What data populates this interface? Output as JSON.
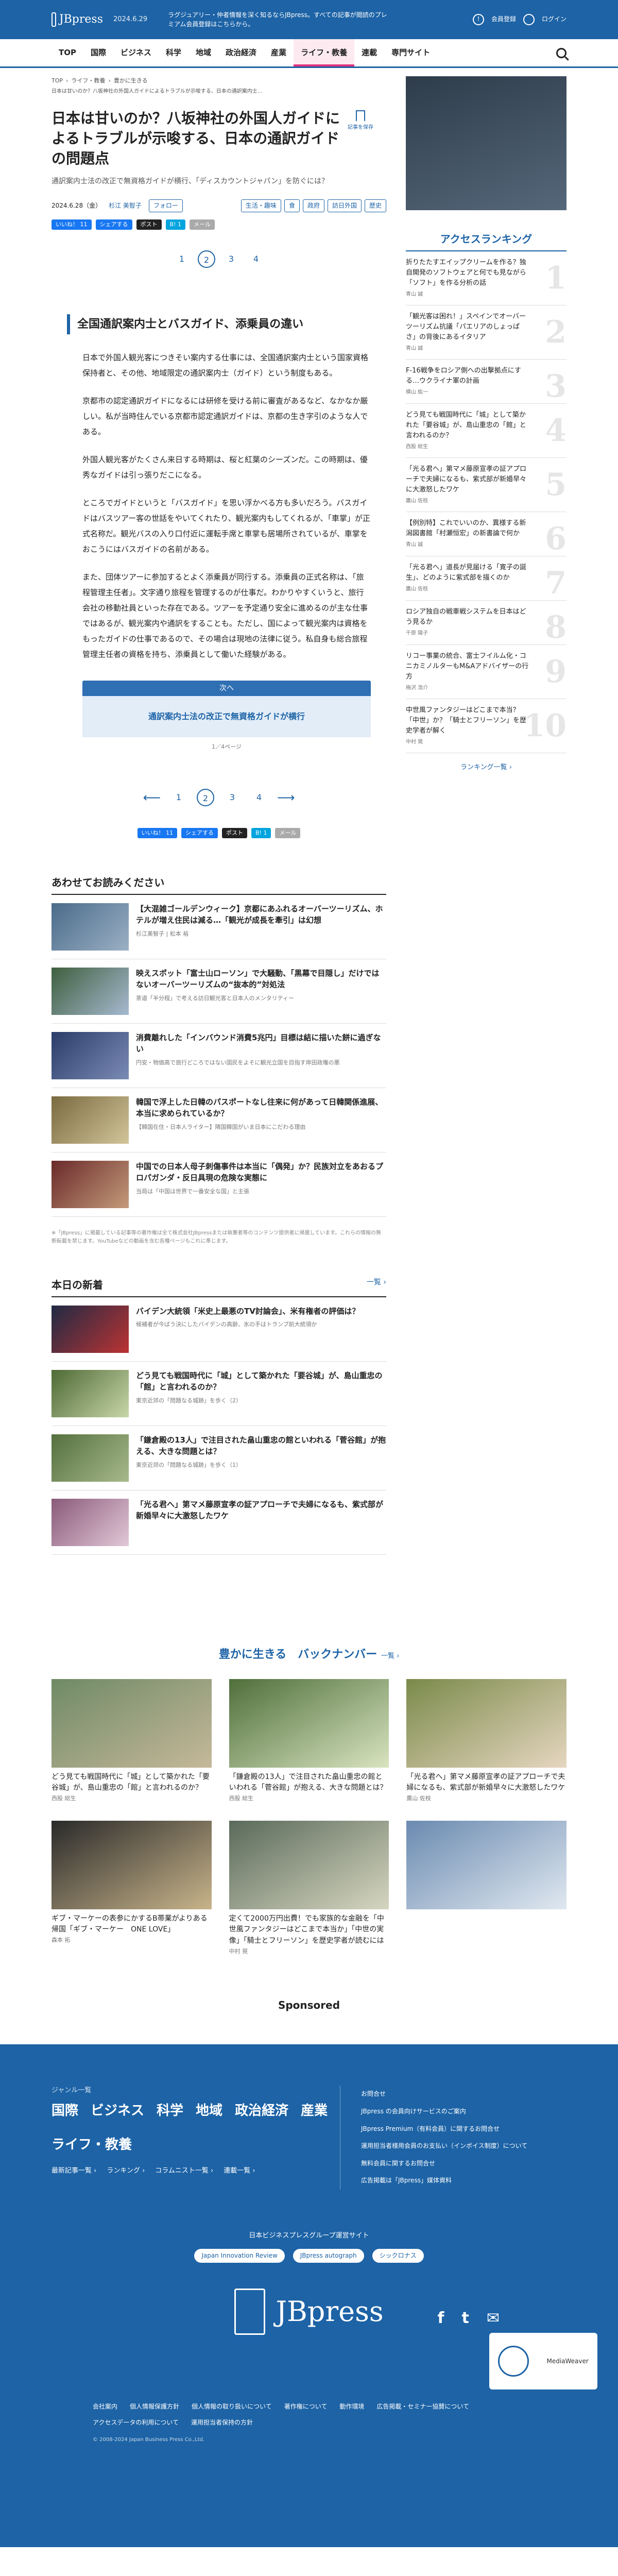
{
  "topbar": {
    "logo": "JBpress",
    "date": "2024.6.29",
    "tagline": "ラグジュアリー・仲者情報を深く知るならJBpress。すべての記事が閲読のプレミアム会員登録はこちらから。",
    "member": "会員登録",
    "login": "ログイン"
  },
  "nav": [
    "TOP",
    "国際",
    "ビジネス",
    "科学",
    "地域",
    "政治経済",
    "産業",
    "ライフ・教養",
    "連載",
    "専門サイト"
  ],
  "breadcrumb": [
    "TOP",
    "ライフ・教養",
    "豊かに生きる"
  ],
  "breadcrumb2": "日本は甘いのか？八坂神社の外国人ガイドによるトラブルが示唆する、日本の通訳案内士...",
  "bookmark": "記事を保存",
  "article": {
    "title": "日本は甘いのか？八坂神社の外国人ガイドによるトラブルが示唆する、日本の通訳ガイドの問題点",
    "lead": "通訳案内士法の改正で無資格ガイドが横行、「ディスカウントジャパン」を防ぐには？",
    "date": "2024.6.28（金）",
    "author": "杉江 美智子",
    "follow": "フォロー",
    "tags": [
      "生活・趣味",
      "食",
      "政府",
      "訪日外国",
      "歴史"
    ],
    "share": [
      "いいね！ 11",
      "シェアする",
      "ポスト",
      "B! 1",
      "メール"
    ],
    "pages": [
      "1",
      "2",
      "3",
      "4"
    ],
    "h2": "全国通訳案内士とバスガイド、添乗員の違い",
    "paras": [
      "日本で外国人観光客につきそい案内する仕事には、全国通訳案内士という国家資格保持者と、その他、地域限定の通訳案内士（ガイド）という制度もある。",
      "京都市の認定通訳ガイドになるには研修を受ける前に審査があるなど、なかなか厳しい。私が当時住んでいる京都市認定通訳ガイドは、京都の生き字引のような人である。",
      "外国人観光客がたくさん来日する時期は、桜と紅葉のシーズンだ。この時期は、優秀なガイドは引っ張りだこになる。",
      "ところでガイドというと「バスガイド」を思い浮かべる方も多いだろう。バスガイドはバスツアー客の世話をやいてくれたり、観光案内もしてくれるが、「車掌」が正式名称だ。観光バスの入り口付近に運転手席と車掌も居場所されているが、車掌をおこうにはバスガイドの名前がある。",
      "また、団体ツアーに参加するとよく添乗員が同行する。添乗員の正式名称は、「旅程管理主任者」。文字通り旅程を管理するのが仕事だ。わかりやすくいうと、旅行会社の移動社員といった存在である。ツアーを予定通り安全に進めるのが主な仕事ではあるが、観光案内や通訳をすることも。ただし、国によって観光案内は資格をもったガイドの仕事であるので、その場合は現地の法律に従う。私自身も総合旅程管理主任者の資格を持ち、添乗員として働いた経験がある。"
    ],
    "next_label": "次へ",
    "next_title": "通訳案内士法の改正で無資格ガイドが横行",
    "page_count": "1／4ページ",
    "share2": [
      "いいね！ 11",
      "シェアする",
      "ポスト",
      "B! 1",
      "メール"
    ]
  },
  "also_read": {
    "title": "あわせてお読みください",
    "items": [
      {
        "t": "【大混雑ゴールデンウィーク】京都にあふれるオーバーツーリズム、ホテルが増え住民は減る…「観光が成長を牽引」は幻想",
        "a": "杉江美智子 | 松本 裕"
      },
      {
        "t": "映えスポット「富士山ローソン」で大騒動、「黒幕で目隠し」だけではないオーバーツーリズムの“抜本的”対処法",
        "a": "茶道「半分程」で考える訪日観光客と日本人のメンタリティー"
      },
      {
        "t": "消費離れした「インバウンド消費5兆円」目標は結に描いた餅に過ぎない",
        "a": "円安・物価高で旅行どころではない国民をよそに観光立国を目指す岸田政権の悪"
      },
      {
        "t": "韓国で浮上した日韓のパスポートなし往来に何があって日韓関係進展、本当に求められているか？",
        "a": "【韓国在住・日本人ライター】隣国韓国がいま日本にこだわる理由"
      },
      {
        "t": "中国での日本人母子刺傷事件は本当に「偶発」か？民族対立をあおるプロパガンダ・反日具現の危険な実態に",
        "a": "当局は「中国は世界で一番安全な国」と主張"
      }
    ],
    "note": "※「JBpress」に掲載している記事等の著作権は全て株式会社JBpressまたは執筆者等のコンテンツ提供者に帰属しています。これらの情報の無断転載を禁じます。YouTubeなどの動画を含む各種ページもこれに準じます。"
  },
  "today": {
    "title": "本日の新着",
    "more": "一覧 ›",
    "items": [
      {
        "t": "バイデン大統領「米史上最悪のTV討論会」、米有権者の評価は？",
        "a": "候補者が今ばう決にしたバイデンの高齢、氷の手はトランプ前大統領か"
      },
      {
        "t": "どう見ても戦国時代に「城」として築かれた「要谷城」が、島山重忠の「館」と言われるのか？",
        "a": "東京近郊の「問題なる城跡」を歩く（2）"
      },
      {
        "t": "「鎌倉殿の13人」で注目された畠山重忠の館といわれる「菅谷館」が抱える、大きな問題とは？",
        "a": "東京近郊の「問題なる城跡」を歩く（1）"
      },
      {
        "t": "「光る君へ」第マメ藤原宣孝の証アプローチで夫婦になるも、紫式部が新婚早々に大激怒したワケ",
        "a": ""
      }
    ]
  },
  "sidebar": {
    "ranking_title": "アクセスランキング",
    "ranking": [
      {
        "t": "折りたたすエイップクリームを作る？独自開発のソフトウェアと何でも見ながら「ソフト」を作る分析の話",
        "a": "青山 誠"
      },
      {
        "t": "「観光客は困れ！」スペインでオーバーツーリズム抗議「パエリアのしょっぱさ」の背後にあるイタリア",
        "a": "青山 誠"
      },
      {
        "t": "F-16戦争をロシア側への出撃拠点にする…ウクライナ軍の計画",
        "a": "横山 紘一"
      },
      {
        "t": "どう見ても戦国時代に「城」として築かれた「要谷城」が、島山重忠の「館」と言われるのか？",
        "a": "西股 総生"
      },
      {
        "t": "「光る君へ」第マメ藤原宣孝の証アプローチで夫婦になるも、紫式部が新婚早々に大激怒したワケ",
        "a": "鷹山 佐枝"
      },
      {
        "t": "【例別特】これでいいのか、異様する新潟図書館「村瀬恒宏」の新書論で何か",
        "a": "青山 誠"
      },
      {
        "t": "「光る君へ」道長が見届ける「寛子の誕生」、どのように紫式部を描くのか",
        "a": "鷹山 佐枝"
      },
      {
        "t": "ロシア独自の戦車戦システムを日本はどう見るか",
        "a": "千原 陽子"
      },
      {
        "t": "リコー事業の統合、富士フイルム化・コニカミノルターもM&Aアドバイザーの行方",
        "a": "梅沢 浩介"
      },
      {
        "t": "中世風ファンタジーはどこまで本当？「中世」か？「騎士とフリーソン」を歴史学者が解く",
        "a": "中村 晃"
      }
    ],
    "ranking_more": "ランキング一覧 ›"
  },
  "backnumber": {
    "title": "豊かに生きる　バックナンバー",
    "more": "一覧 ›",
    "items": [
      {
        "t": "どう見ても戦国時代に「城」として築かれた「要谷城」が、島山重忠の「館」と言われるのか？",
        "a": "西股 総生"
      },
      {
        "t": "「鎌倉殿の13人」で注目された畠山重忠の館といわれる「菅谷館」が抱える、大きな問題とは？",
        "a": "西股 総生"
      },
      {
        "t": "「光る君へ」第マメ藤原宣孝の証アプローチで夫婦になるも、紫式部が新婚早々に大激怒したワケ",
        "a": "鷹山 佐枝"
      },
      {
        "t": "ギブ・マーケーの表参にかするB帯業がよりある帰国「ギブ・マーケー　ONE LOVE」",
        "a": "森本 拓"
      },
      {
        "t": "定くて2000万円出費！でも家族的な金融を「中世風ファンタジーはどこまで本当か」「中世の実像」「騎士とフリーソン」を歴史学者が読むには",
        "a": "中村 晃"
      },
      {
        "t": "",
        "a": ""
      }
    ]
  },
  "sponsored": "Sponsored",
  "footer": {
    "genre_label": "ジャンル一覧",
    "genres": [
      "国際",
      "ビジネス",
      "科学",
      "地域",
      "政治経済",
      "産業",
      "ライフ・教養"
    ],
    "sub": [
      "最新記事一覧 ›",
      "ランキング ›",
      "コラムニスト一覧 ›",
      "連載一覧 ›"
    ],
    "links": [
      "お問合せ",
      "JBpress の会員向けサービスのご案内",
      "JBpress Premium（有料会員）に関するお問合せ",
      "運用担当者様用会員のお支払い（インボイス制度）について",
      "無料会員に関するお問合せ",
      "広告掲載は「JBpress」媒体資料"
    ],
    "group_label": "日本ビジネスプレスグループ運営サイト",
    "group": [
      "Japan Innovation Review",
      "JBpress autograph",
      "シックロナス"
    ],
    "logo": "JBpress",
    "social": [
      "f",
      "t",
      "✉"
    ],
    "badge": "MediaWeaver",
    "bottom": [
      "会社案内",
      "個人情報保護方針",
      "個人情報の取り扱いについて",
      "著作権について",
      "動作環境",
      "広告掲載・セミナー協賛について",
      "アクセスデータの利用について",
      "運用担当者保持の方針"
    ],
    "copyright": "© 2008-2024 Japan Business Press Co.,Ltd."
  }
}
